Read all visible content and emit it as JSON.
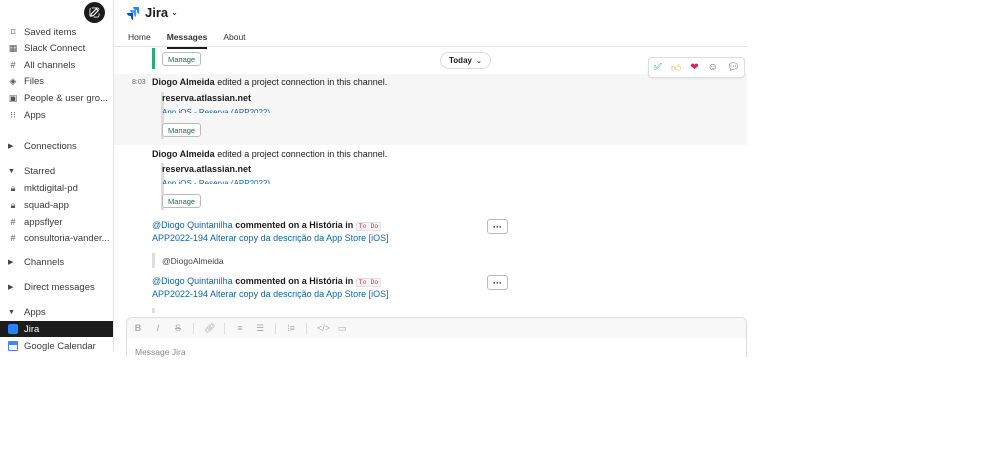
{
  "sidebar": {
    "items": [
      {
        "label": "Saved items",
        "icon": "bookmark-icon"
      },
      {
        "label": "Slack Connect",
        "icon": "building-icon"
      },
      {
        "label": "All channels",
        "icon": "hash-icon"
      },
      {
        "label": "Files",
        "icon": "files-icon"
      },
      {
        "label": "People & user gro...",
        "icon": "people-icon"
      },
      {
        "label": "Apps",
        "icon": "apps-grid-icon"
      }
    ],
    "connections_label": "Connections",
    "starred_label": "Starred",
    "starred": [
      "mktdigital-pd",
      "squad-app",
      "appsflyer",
      "consultoria-vander..."
    ],
    "channels_label": "Channels",
    "dms_label": "Direct messages",
    "apps_label": "Apps",
    "apps": [
      "Jira",
      "Google Calendar"
    ]
  },
  "header": {
    "title": "Jira",
    "tabs": [
      "Home",
      "Messages",
      "About"
    ]
  },
  "messages": {
    "today_label": "Today",
    "manage_label": "Manage",
    "m1": {
      "time": "8:03",
      "author": "Diogo Almeida",
      "text": "edited a project connection in this channel.",
      "domain": "reserva.atlassian.net",
      "project": "App iOS - Reserva (APP2022)"
    },
    "m2": {
      "author": "Diogo Almeida",
      "text": "edited a project connection in this channel.",
      "domain": "reserva.atlassian.net",
      "project": "App iOS - Reserva (APP2022)"
    },
    "m3": {
      "mention": "@Diogo Quintanilha",
      "text_before": "commented on a História in",
      "status": "To Do",
      "issue": "APP2022-194 Alterar copy da descrição da App Store [iOS]",
      "quote": "@DiogoAlmeida"
    },
    "m4": {
      "mention": "@Diogo Quintanilha",
      "text_before": "commented on a História in",
      "status": "To Do",
      "issue": "APP2022-194 Alterar copy da descrição da App Store [iOS]"
    },
    "more_label": "···"
  },
  "composer": {
    "placeholder": "Message Jira",
    "tools": [
      "B",
      "I",
      "S"
    ]
  },
  "colors": {
    "accent_green": "#2bac76",
    "link_blue": "#1264a3",
    "jira_blue": "#2684ff"
  }
}
